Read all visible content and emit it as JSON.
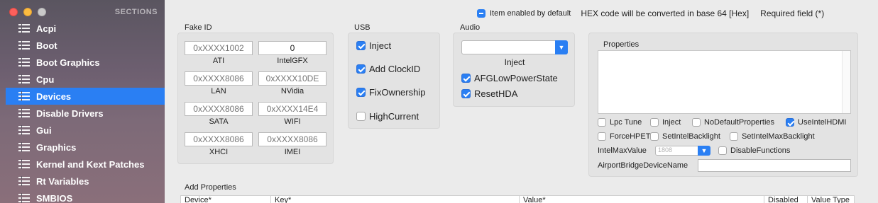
{
  "sidebar": {
    "header": "SECTIONS",
    "items": [
      {
        "label": "Acpi"
      },
      {
        "label": "Boot"
      },
      {
        "label": "Boot Graphics"
      },
      {
        "label": "Cpu"
      },
      {
        "label": "Devices"
      },
      {
        "label": "Disable Drivers"
      },
      {
        "label": "Gui"
      },
      {
        "label": "Graphics"
      },
      {
        "label": "Kernel and Kext Patches"
      },
      {
        "label": "Rt Variables"
      },
      {
        "label": "SMBIOS"
      }
    ],
    "active_index": 4
  },
  "topbar": {
    "default_label": "Item enabled by default",
    "hex_note": "HEX code will be converted in base 64 [Hex]",
    "required_note": "Required field (*)"
  },
  "fake_id": {
    "title": "Fake ID",
    "fields": [
      {
        "label": "ATI",
        "value": "",
        "placeholder": "0xXXXX1002"
      },
      {
        "label": "IntelGFX",
        "value": "0",
        "placeholder": ""
      },
      {
        "label": "LAN",
        "value": "",
        "placeholder": "0xXXXX8086"
      },
      {
        "label": "NVidia",
        "value": "",
        "placeholder": "0xXXXX10DE"
      },
      {
        "label": "SATA",
        "value": "",
        "placeholder": "0xXXXX8086"
      },
      {
        "label": "WIFI",
        "value": "",
        "placeholder": "0xXXXX14E4"
      },
      {
        "label": "XHCI",
        "value": "",
        "placeholder": "0xXXXX8086"
      },
      {
        "label": "IMEI",
        "value": "",
        "placeholder": "0xXXXX8086"
      }
    ]
  },
  "usb": {
    "title": "USB",
    "options": [
      {
        "label": "Inject",
        "checked": true
      },
      {
        "label": "Add ClockID",
        "checked": true
      },
      {
        "label": "FixOwnership",
        "checked": true
      },
      {
        "label": "HighCurrent",
        "checked": false
      }
    ]
  },
  "audio": {
    "title": "Audio",
    "inject_value": "",
    "inject_label": "Inject",
    "options": [
      {
        "label": "AFGLowPowerState",
        "checked": true
      },
      {
        "label": "ResetHDA",
        "checked": true
      }
    ]
  },
  "properties": {
    "title": "Properties",
    "options_row1": [
      {
        "label": "Lpc Tune",
        "checked": false
      },
      {
        "label": "Inject",
        "checked": false
      },
      {
        "label": "NoDefaultProperties",
        "checked": false
      },
      {
        "label": "UseIntelHDMI",
        "checked": true
      }
    ],
    "options_row2": [
      {
        "label": "ForceHPET",
        "checked": false
      },
      {
        "label": "SetIntelBacklight",
        "checked": false
      },
      {
        "label": "SetIntelMaxBacklight",
        "checked": false
      }
    ],
    "intel_max_value_label": "IntelMaxValue",
    "intel_max_value": "1808",
    "disable_functions_label": "DisableFunctions",
    "airport_label": "AirportBridgeDeviceName",
    "airport_value": ""
  },
  "add_properties": {
    "title": "Add Properties",
    "columns": [
      "Device*",
      "Key*",
      "Value*",
      "Disabled",
      "Value Type"
    ]
  }
}
